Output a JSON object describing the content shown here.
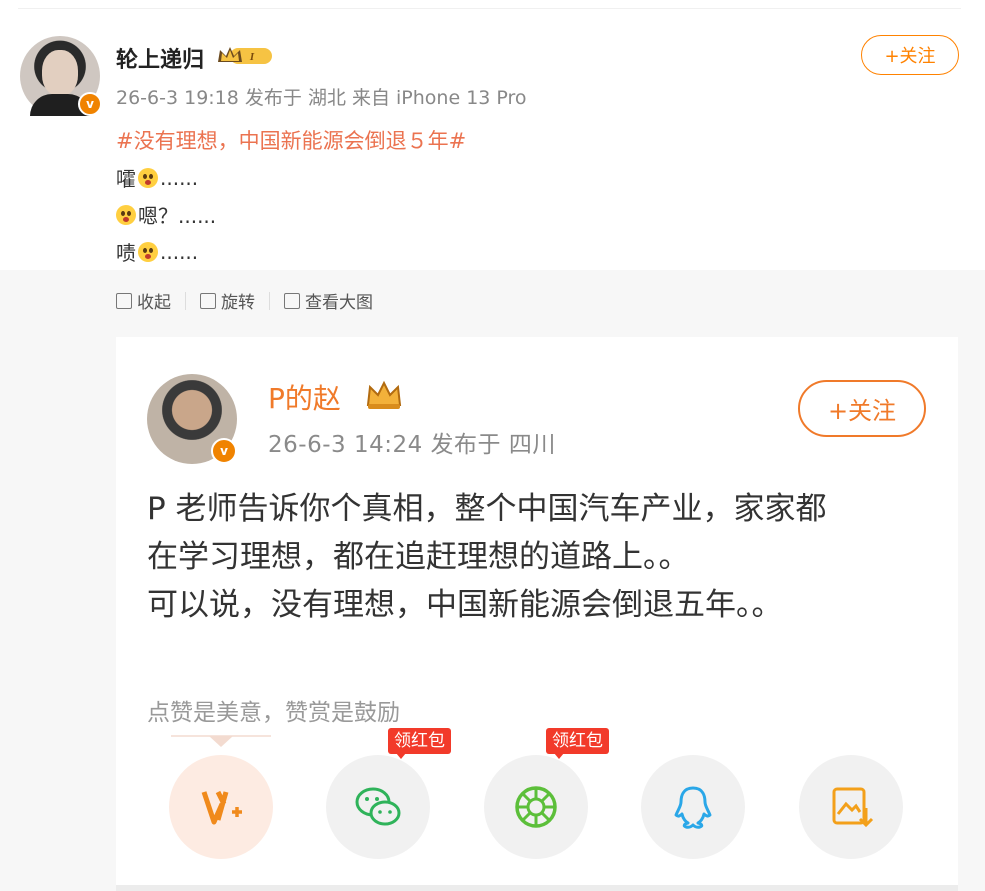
{
  "post": {
    "author": "轮上递归",
    "level_badge": "I",
    "meta": "26-6-3 19:18 发布于 湖北 来自 iPhone 13 Pro",
    "follow_label": "+关注",
    "topic": "#没有理想，中国新能源会倒退５年#",
    "lines": [
      {
        "prefix": "嚯",
        "suffix": "......"
      },
      {
        "prefix": "",
        "suffix": "嗯？......"
      },
      {
        "prefix": "啧",
        "suffix": "......"
      }
    ]
  },
  "image_toolbar": {
    "collapse": "收起",
    "rotate": "旋转",
    "view_large": "查看大图"
  },
  "embedded": {
    "author": "P的赵",
    "meta": "26-6-3 14:24  发布于 四川",
    "follow_label": "+关注",
    "body": [
      "P 老师告诉你个真相，整个中国汽车产业，家家都",
      "在学习理想，都在追赶理想的道路上。。",
      "可以说，没有理想，中国新能源会倒退五年。。"
    ],
    "tip": "点赞是美意，赞赏是鼓励",
    "share": [
      {
        "icon": "v-plus-icon",
        "badge": ""
      },
      {
        "icon": "wechat-icon",
        "badge": "领红包"
      },
      {
        "icon": "moments-icon",
        "badge": "领红包"
      },
      {
        "icon": "qq-icon",
        "badge": ""
      },
      {
        "icon": "save-image-icon",
        "badge": ""
      }
    ]
  },
  "colors": {
    "accent": "#ff8200",
    "topic": "#eb7350",
    "verified": "#f08300",
    "red_packet": "#f23a2a"
  }
}
